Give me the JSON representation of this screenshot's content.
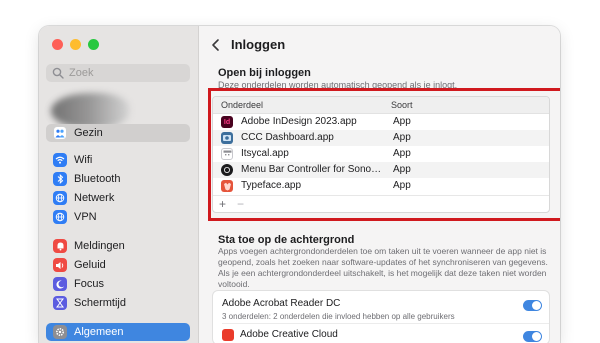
{
  "window": {
    "title": "Inloggen",
    "traffic_lights": {
      "close": "#fe5f57",
      "minimize": "#febc2e",
      "zoom": "#28c840"
    }
  },
  "sidebar": {
    "search_placeholder": "Zoek",
    "items": [
      {
        "label": "Gezin",
        "icon": "family-icon",
        "color": "#ffffff",
        "state": "active"
      },
      {
        "label": "Wifi",
        "icon": "wifi-icon",
        "color": "#2f7df5"
      },
      {
        "label": "Bluetooth",
        "icon": "bluetooth-icon",
        "color": "#2f7df5"
      },
      {
        "label": "Netwerk",
        "icon": "globe-icon",
        "color": "#2f7df5"
      },
      {
        "label": "VPN",
        "icon": "vpn-globe-icon",
        "color": "#2f7df5"
      },
      {
        "label": "Meldingen",
        "icon": "bell-icon",
        "color": "#ef4a43"
      },
      {
        "label": "Geluid",
        "icon": "speaker-icon",
        "color": "#ef4a43"
      },
      {
        "label": "Focus",
        "icon": "moon-icon",
        "color": "#5c5ce0"
      },
      {
        "label": "Schermtijd",
        "icon": "hourglass-icon",
        "color": "#5c5ce0"
      },
      {
        "label": "Algemeen",
        "icon": "gear-icon",
        "color": "#8e8e93",
        "state": "selected"
      }
    ]
  },
  "main": {
    "open_at_login": {
      "title": "Open bij inloggen",
      "subtitle": "Deze onderdelen worden automatisch geopend als je inlogt.",
      "columns": {
        "item": "Onderdeel",
        "kind": "Soort"
      },
      "rows": [
        {
          "name": "Adobe InDesign 2023.app",
          "kind": "App",
          "icon": "indesign-icon",
          "color": "#49021f",
          "glyph": "Id"
        },
        {
          "name": "CCC Dashboard.app",
          "kind": "App",
          "icon": "ccc-dashboard-icon",
          "color": "#3d6f9c",
          "glyph": ""
        },
        {
          "name": "Itsycal.app",
          "kind": "App",
          "icon": "calendar-icon",
          "color": "#ffffff",
          "glyph": ""
        },
        {
          "name": "Menu Bar Controller for Sono…",
          "kind": "App",
          "icon": "sonos-icon",
          "color": "#1c1c1e",
          "glyph": ""
        },
        {
          "name": "Typeface.app",
          "kind": "App",
          "icon": "typeface-icon",
          "color": "#e5543b",
          "glyph": ""
        }
      ],
      "add_label": "+",
      "remove_label": "−"
    },
    "background": {
      "title": "Sta toe op de achtergrond",
      "description": "Apps voegen achtergrondonderdelen toe om taken uit te voeren wanneer de app niet is geopend, zoals het zoeken naar software-updates of het synchroniseren van gegevens. Als je een achtergrondonderdeel uitschakelt, is het mogelijk dat deze taken niet worden voltooid.",
      "items": [
        {
          "title": "Adobe Acrobat Reader DC",
          "subtitle": "3 onderdelen: 2 onderdelen die invloed hebben op alle gebruikers",
          "enabled": true
        },
        {
          "title": "Adobe Creative Cloud",
          "subtitle": "",
          "enabled": true
        }
      ]
    }
  }
}
